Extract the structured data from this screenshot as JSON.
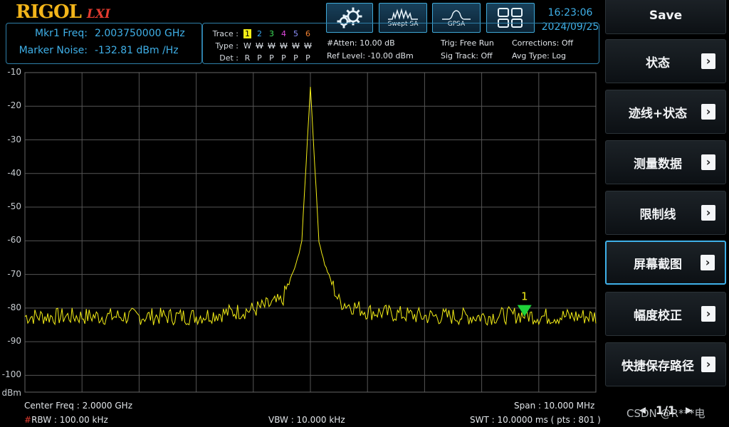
{
  "header": {
    "brand": "RIGOL",
    "lxi": "LXI",
    "modes": [
      {
        "label": "",
        "icon": "settings-gears-icon"
      },
      {
        "label": "Swept SA",
        "icon": "swept-sa-icon"
      },
      {
        "label": "GPSA",
        "icon": "gpsa-icon"
      },
      {
        "label": "",
        "icon": "window-layout-icon"
      }
    ],
    "time": "16:23:06",
    "date": "2024/09/25"
  },
  "marker_info": {
    "freq_label": "Mkr1 Freq:",
    "freq_value": "2.003750000 GHz",
    "noise_label": "Marker Noise:",
    "noise_value": "-132.81 dBm /Hz"
  },
  "trace_info": {
    "trace_label": "Trace :",
    "type_label": "Type :",
    "det_label": "Det :",
    "traces": [
      {
        "num": "1",
        "type": "W",
        "det": "R",
        "color": "#f4ee16"
      },
      {
        "num": "2",
        "type": "W",
        "det": "P",
        "color": "#3aa8f0"
      },
      {
        "num": "3",
        "type": "W",
        "det": "P",
        "color": "#3fe05a"
      },
      {
        "num": "4",
        "type": "W",
        "det": "P",
        "color": "#e04ae0"
      },
      {
        "num": "5",
        "type": "W",
        "det": "P",
        "color": "#8e92ff"
      },
      {
        "num": "6",
        "type": "W",
        "det": "P",
        "color": "#f08030"
      }
    ],
    "atten": "#Atten: 10.00 dB",
    "ref_level": "Ref Level: -10.00 dBm",
    "trig": "Trig: Free Run",
    "sig_track": "Sig Track: Off",
    "corrections": "Corrections: Off",
    "avg_type": "Avg Type: Log"
  },
  "plot": {
    "y_ticks": [
      "-10",
      "-20",
      "-30",
      "-40",
      "-50",
      "-60",
      "-70",
      "-80",
      "-90",
      "-100"
    ],
    "y_unit": "dBm",
    "marker_label": "1",
    "trace_color": "#f4ee16",
    "marker_color": "#1fd23a"
  },
  "footer": {
    "center_freq": "Center Freq : 2.0000 GHz",
    "span": "Span : 10.000 MHz",
    "rbw_hash": "#",
    "rbw": "RBW : 100.00 kHz",
    "vbw": "VBW : 10.000 kHz",
    "swt": "SWT : 10.0000 ms ( pts : 801 )"
  },
  "sidebar": {
    "items": [
      {
        "label": "Save",
        "arrow": false,
        "active": false
      },
      {
        "label": "状态",
        "arrow": true,
        "active": false
      },
      {
        "label": "迹线+状态",
        "arrow": true,
        "active": false
      },
      {
        "label": "测量数据",
        "arrow": true,
        "active": false
      },
      {
        "label": "限制线",
        "arrow": true,
        "active": false
      },
      {
        "label": "屏幕截图",
        "arrow": true,
        "active": true
      },
      {
        "label": "幅度校正",
        "arrow": true,
        "active": false
      },
      {
        "label": "快捷保存路径",
        "arrow": true,
        "active": false
      }
    ],
    "page": "1/1",
    "watermark": "CSDN @R***电"
  },
  "chart_data": {
    "type": "line",
    "title": "",
    "xlabel": "",
    "ylabel": "dBm",
    "ylim": [
      -105,
      -10
    ],
    "x_center_ghz": 2.0,
    "x_span_mhz": 10.0,
    "series": [
      {
        "x_mhz": [
          1995.0,
          1996.0,
          1997.0,
          1998.0,
          1999.0,
          1999.5,
          1999.75,
          1999.85,
          2000.0,
          2000.15,
          2000.25,
          2000.5,
          2001.0,
          2002.0,
          2003.0,
          2003.75,
          2004.0,
          2005.0
        ],
        "values": [
          -82.5,
          -82.5,
          -82.5,
          -82.5,
          -80.5,
          -78.0,
          -67.0,
          -60.0,
          -14.0,
          -60.0,
          -67.0,
          -78.0,
          -81.0,
          -82.5,
          -82.5,
          -82.0,
          -82.5,
          -82.5
        ]
      }
    ],
    "marker": {
      "label": "1",
      "x_mhz": 2003.75,
      "value": -81.0
    },
    "grid": true
  }
}
